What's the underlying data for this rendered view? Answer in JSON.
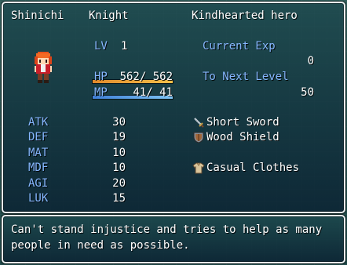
{
  "actor": {
    "name": "Shinichi",
    "class": "Knight",
    "nickname": "Kindhearted hero",
    "level_label": "LV",
    "level": "1",
    "hp_label": "HP",
    "hp_text": "562/ 562",
    "hp_fraction": 1.0,
    "mp_label": "MP",
    "mp_text": "41/  41",
    "mp_fraction": 1.0,
    "current_exp_label": "Current Exp",
    "current_exp": "0",
    "next_level_label": "To Next Level",
    "next_level": "50"
  },
  "params": [
    {
      "label": "ATK",
      "value": "30"
    },
    {
      "label": "DEF",
      "value": "19"
    },
    {
      "label": "MAT",
      "value": "10"
    },
    {
      "label": "MDF",
      "value": "10"
    },
    {
      "label": "AGI",
      "value": "20"
    },
    {
      "label": "LUK",
      "value": "15"
    }
  ],
  "equips": [
    {
      "icon": "sword-icon",
      "name": "Short Sword"
    },
    {
      "icon": "shield-icon",
      "name": "Wood Shield"
    },
    {
      "icon": "",
      "name": ""
    },
    {
      "icon": "clothes-icon",
      "name": "Casual Clothes"
    }
  ],
  "profile": {
    "line1": "Can't stand injustice and tries to help as many",
    "line2": "people in need as possible."
  },
  "colors": {
    "system_text": "#86b7ff",
    "hp_gauge_start": "#e08a2c",
    "hp_gauge_end": "#f2c04a",
    "mp_gauge_start": "#3f80d8",
    "mp_gauge_end": "#7ec4f4"
  }
}
